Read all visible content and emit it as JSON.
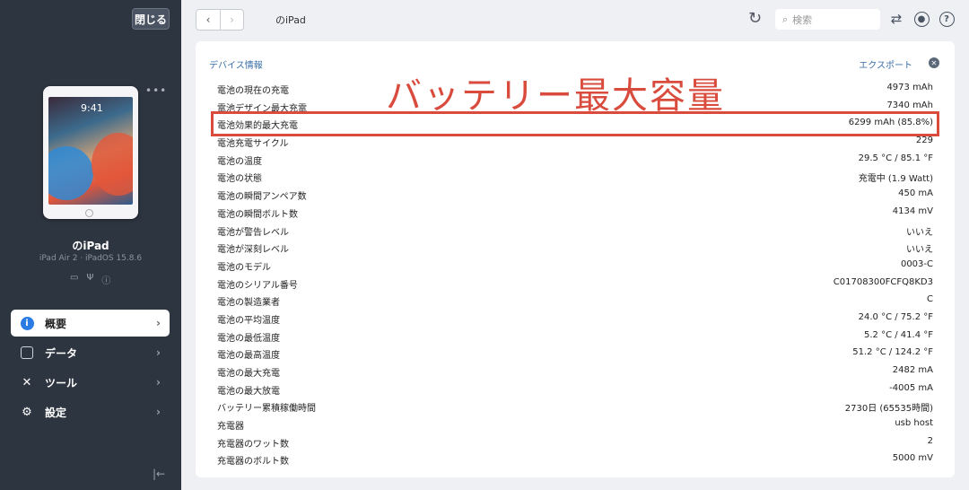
{
  "sidebar": {
    "close_label": "閉じる",
    "device_time": "9:41",
    "device_name": "のiPad",
    "device_sub": "iPad Air 2 · iPadOS 15.8.6",
    "nav": [
      {
        "label": "概要",
        "icon": "info-icon",
        "active": true
      },
      {
        "label": "データ",
        "icon": "square-icon",
        "active": false
      },
      {
        "label": "ツール",
        "icon": "tools-icon",
        "active": false
      },
      {
        "label": "設定",
        "icon": "gear-icon",
        "active": false
      }
    ]
  },
  "topbar": {
    "title": "のiPad",
    "search_placeholder": "検索"
  },
  "panel": {
    "section_title": "デバイス情報",
    "export_label": "エクスポート",
    "annotation": "バッテリー最大容量",
    "rows": [
      {
        "k": "電池の現在の充電",
        "v": "4973 mAh"
      },
      {
        "k": "電池デザイン最大充電",
        "v": "7340 mAh"
      },
      {
        "k": "電池効果的最大充電",
        "v": "6299 mAh (85.8%)"
      },
      {
        "k": "電池充電サイクル",
        "v": "229"
      },
      {
        "k": "電池の温度",
        "v": "29.5 °C / 85.1 °F"
      },
      {
        "k": "電池の状態",
        "v": "充電中 (1.9 Watt)"
      },
      {
        "k": "電池の瞬間アンペア数",
        "v": "450 mA"
      },
      {
        "k": "電池の瞬間ボルト数",
        "v": "4134 mV"
      },
      {
        "k": "電池が警告レベル",
        "v": "いいえ"
      },
      {
        "k": "電池が深刻レベル",
        "v": "いいえ"
      },
      {
        "k": "電池のモデル",
        "v": "0003-C"
      },
      {
        "k": "電池のシリアル番号",
        "v": "C01708300FCFQ8KD3"
      },
      {
        "k": "電池の製造業者",
        "v": "C"
      },
      {
        "k": "電池の平均温度",
        "v": "24.0 °C / 75.2 °F"
      },
      {
        "k": "電池の最低温度",
        "v": "5.2 °C / 41.4 °F"
      },
      {
        "k": "電池の最高温度",
        "v": "51.2 °C / 124.2 °F"
      },
      {
        "k": "電池の最大充電",
        "v": "2482 mA"
      },
      {
        "k": "電池の最大放電",
        "v": "-4005 mA"
      },
      {
        "k": "バッテリー累積稼働時間",
        "v": "2730日 (65535時間)"
      },
      {
        "k": "充電器",
        "v": "usb host"
      },
      {
        "k": "充電器のワット数",
        "v": "2"
      },
      {
        "k": "充電器のボルト数",
        "v": "5000 mV"
      }
    ]
  },
  "colors": {
    "sidebar_bg": "#2d3540",
    "accent": "#2a7be4",
    "link": "#3a6ea8",
    "annotation": "#d94b3d"
  }
}
